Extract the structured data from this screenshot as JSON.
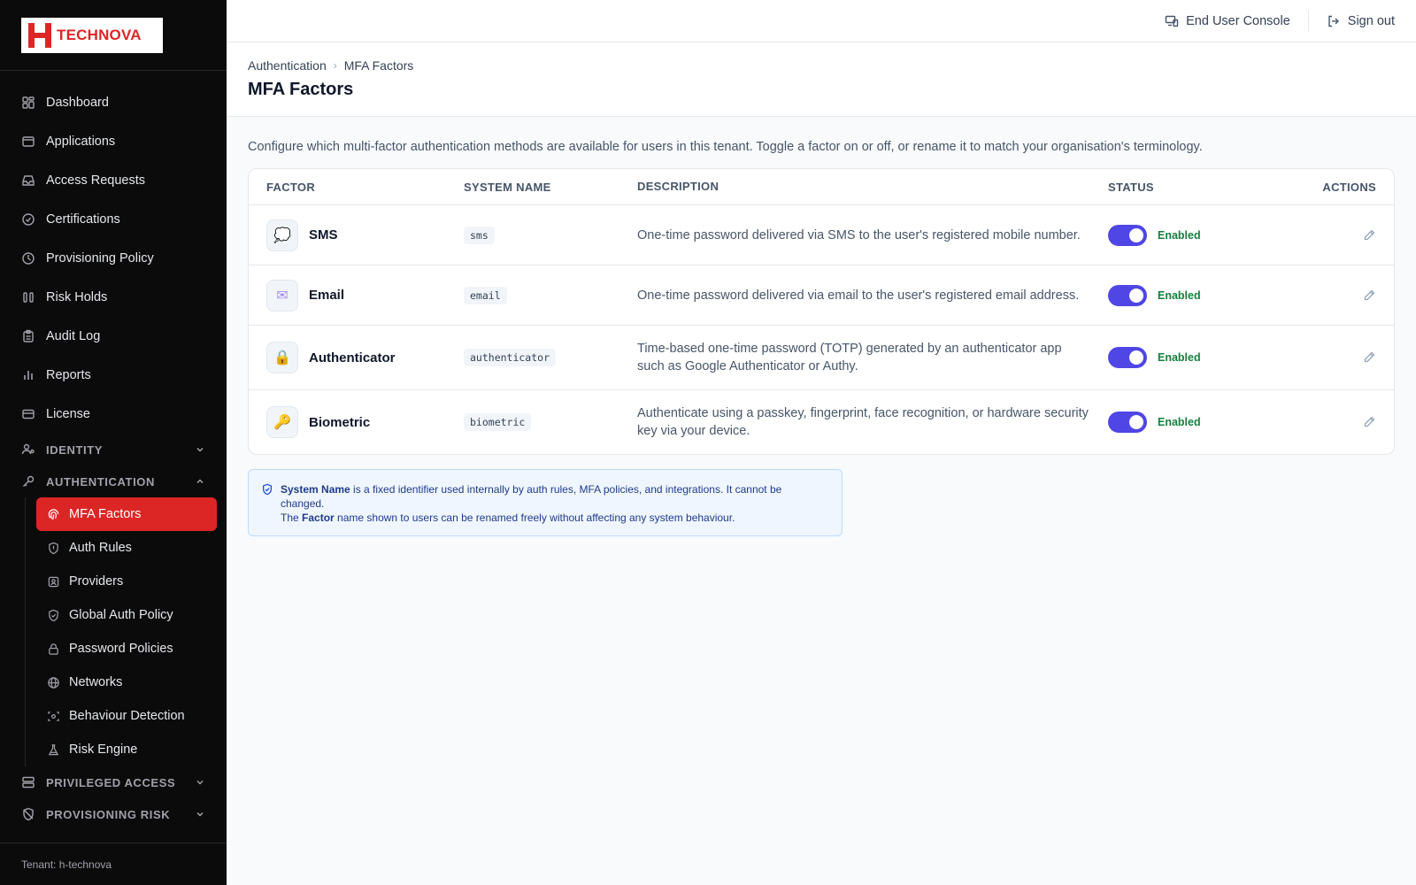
{
  "brand": {
    "logo_text": "TECHNOVA"
  },
  "sidebar": {
    "items": [
      {
        "label": "Dashboard",
        "icon": "grid-icon"
      },
      {
        "label": "Applications",
        "icon": "window-icon"
      },
      {
        "label": "Access Requests",
        "icon": "inbox-icon"
      },
      {
        "label": "Certifications",
        "icon": "check-circle-icon"
      },
      {
        "label": "Provisioning Policy",
        "icon": "policy-icon"
      },
      {
        "label": "Risk Holds",
        "icon": "pause-icon"
      },
      {
        "label": "Audit Log",
        "icon": "clipboard-icon"
      },
      {
        "label": "Reports",
        "icon": "bar-chart-icon"
      },
      {
        "label": "License",
        "icon": "card-icon"
      }
    ],
    "sections": {
      "identity": "IDENTITY",
      "authentication": "AUTHENTICATION",
      "privileged": "PRIVILEGED ACCESS",
      "provisioning_risk": "PROVISIONING RISK"
    },
    "auth_items": [
      {
        "label": "MFA Factors",
        "icon": "fingerprint-icon",
        "active": true
      },
      {
        "label": "Auth Rules",
        "icon": "shield-icon"
      },
      {
        "label": "Providers",
        "icon": "id-badge-icon"
      },
      {
        "label": "Global Auth Policy",
        "icon": "shield-check-icon"
      },
      {
        "label": "Password Policies",
        "icon": "lock-icon"
      },
      {
        "label": "Networks",
        "icon": "globe-icon"
      },
      {
        "label": "Behaviour Detection",
        "icon": "eye-scan-icon"
      },
      {
        "label": "Risk Engine",
        "icon": "beaker-icon"
      }
    ],
    "tenant": "Tenant: h-technova"
  },
  "topbar": {
    "end_user_console": "End User Console",
    "sign_out": "Sign out"
  },
  "header": {
    "breadcrumb": [
      "Authentication",
      "MFA Factors"
    ],
    "title": "MFA Factors"
  },
  "intro": "Configure which multi-factor authentication methods are available for users in this tenant. Toggle a factor on or off, or rename it to match your organisation's terminology.",
  "table": {
    "columns": [
      "FACTOR",
      "SYSTEM NAME",
      "DESCRIPTION",
      "STATUS",
      "ACTIONS"
    ],
    "rows": [
      {
        "factor": "SMS",
        "system_name": "sms",
        "description": "One-time password delivered via SMS to the user's registered mobile number.",
        "status": "Enabled",
        "enabled": true,
        "emoji": "💭",
        "icon": "speech-bubble-icon"
      },
      {
        "factor": "Email",
        "system_name": "email",
        "description": "One-time password delivered via email to the user's registered email address.",
        "status": "Enabled",
        "enabled": true,
        "emoji": "✉",
        "icon": "envelope-icon"
      },
      {
        "factor": "Authenticator",
        "system_name": "authenticator",
        "description": "Time-based one-time password (TOTP) generated by an authenticator app such as Google Authenticator or Authy.",
        "status": "Enabled",
        "enabled": true,
        "emoji": "🔒",
        "icon": "padlock-icon"
      },
      {
        "factor": "Biometric",
        "system_name": "biometric",
        "description": "Authenticate using a passkey, fingerprint, face recognition, or hardware security key via your device.",
        "status": "Enabled",
        "enabled": true,
        "emoji": "🔑",
        "icon": "key-icon"
      }
    ]
  },
  "note": {
    "line1_bold": "System Name",
    "line1_rest": " is a fixed identifier used internally by auth rules, MFA policies, and integrations. It cannot be changed.",
    "line2_pre": "The ",
    "line2_bold": "Factor",
    "line2_rest": " name shown to users can be renamed freely without affecting any system behaviour."
  },
  "colors": {
    "accent": "#dc2626",
    "toggle": "#4f46e5",
    "enabled": "#15803d",
    "sidebar_bg": "#0b0b0c"
  }
}
